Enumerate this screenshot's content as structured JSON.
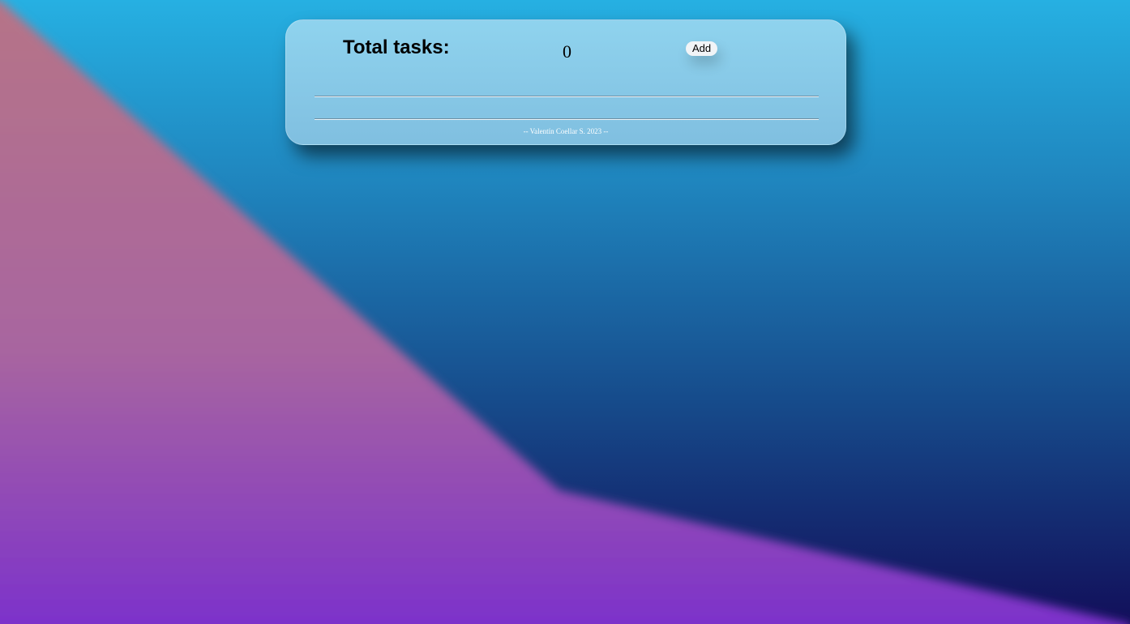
{
  "header": {
    "title": "Total tasks:",
    "count": "0",
    "add_label": "Add"
  },
  "tasks": [],
  "footer": {
    "text": "-- Valentín Coellar S. 2023 --"
  },
  "colors": {
    "panel": "#8fd3ee",
    "background_top": "#26b0e2",
    "background_bottom": "#120f5a",
    "wave": "#b0708a"
  }
}
